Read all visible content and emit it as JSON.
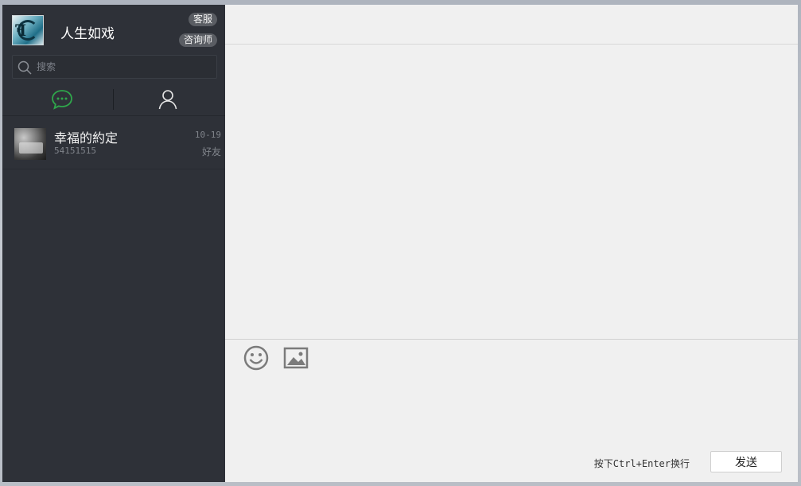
{
  "profile": {
    "username": "人生如戏",
    "support_label": "客服",
    "consultant_label": "咨询师"
  },
  "search": {
    "placeholder": "搜索"
  },
  "tabs": [
    {
      "name": "chat",
      "icon": "chat-bubble-icon",
      "active": true,
      "color": "#2fa64b"
    },
    {
      "name": "contacts",
      "icon": "person-icon",
      "active": false,
      "color": "#e6e6e6"
    }
  ],
  "conversations": [
    {
      "name": "幸福的約定",
      "subtitle": "54151515",
      "date": "10-19",
      "tag": "好友"
    }
  ],
  "composer": {
    "hint": "按下Ctrl+Enter换行",
    "send_label": "发送",
    "tools": [
      "emoji-icon",
      "image-icon"
    ]
  },
  "colors": {
    "sidebar_bg": "#2e3138",
    "main_bg": "#f0f0f0",
    "accent_green": "#2fa64b"
  }
}
